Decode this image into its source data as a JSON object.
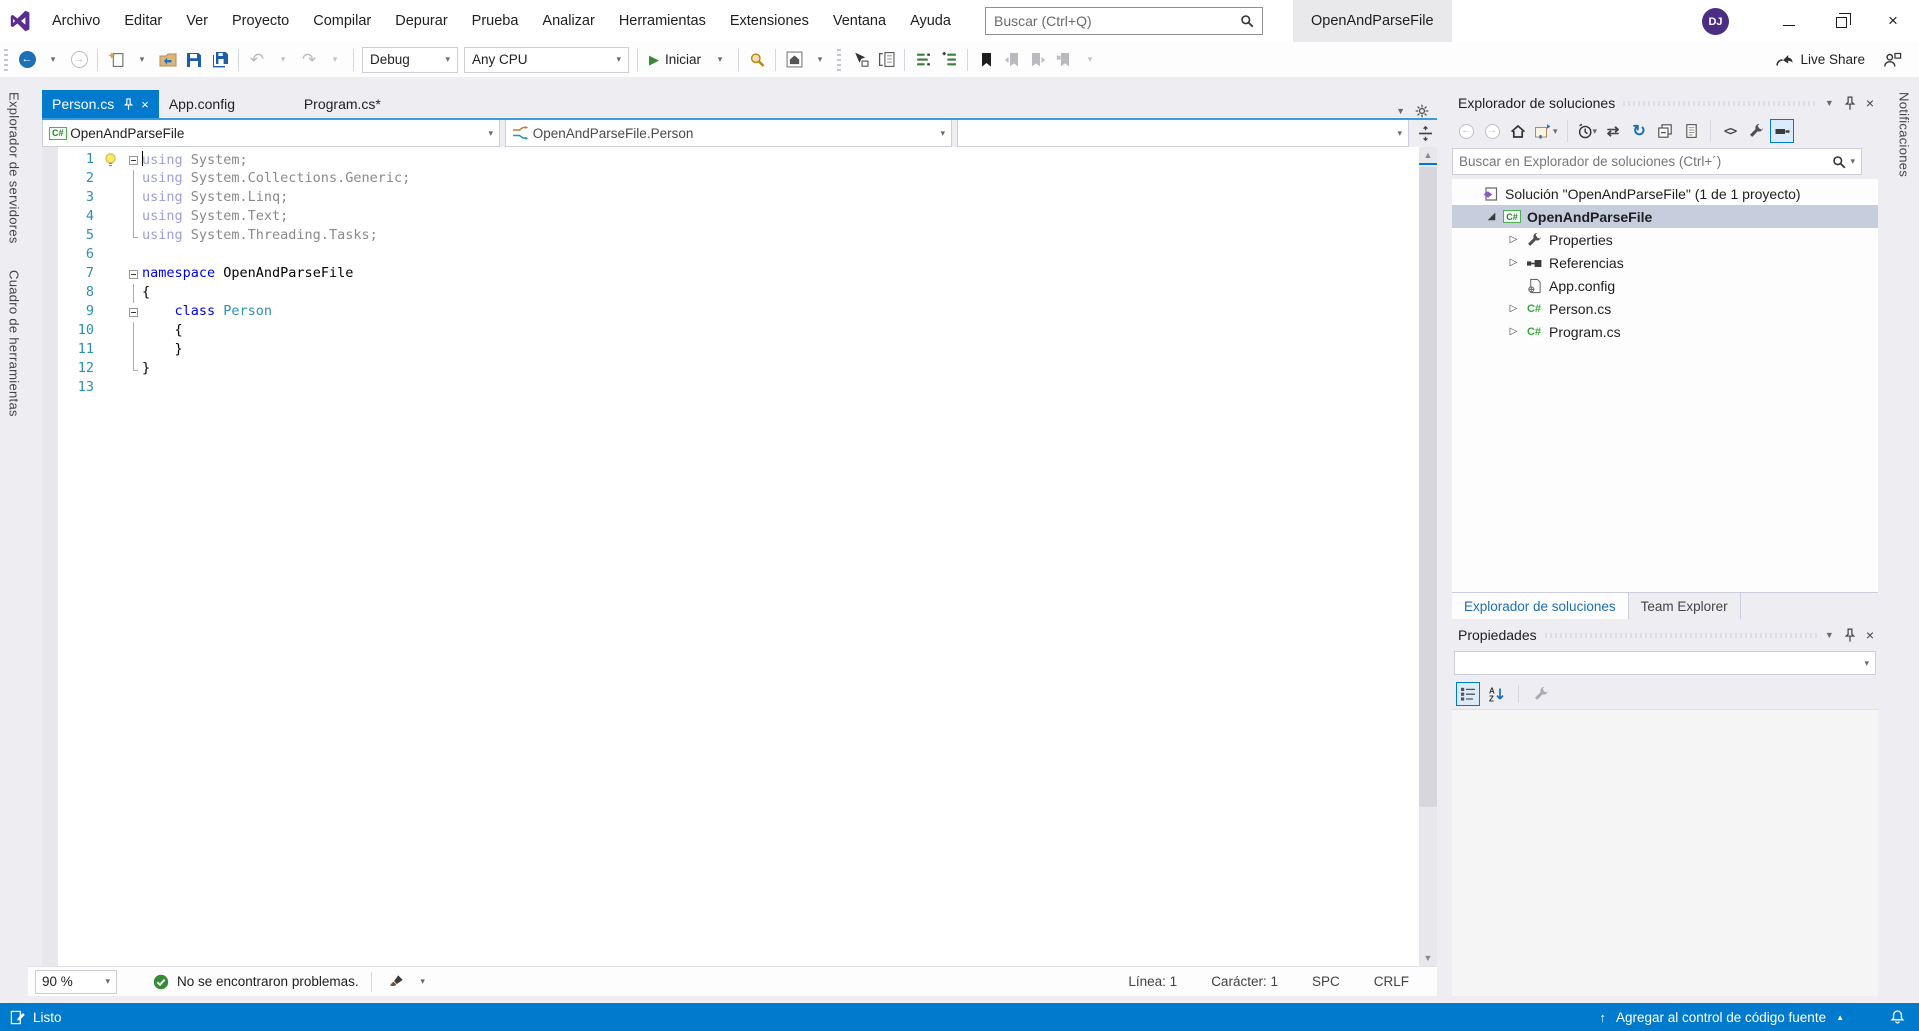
{
  "colors": {
    "accent": "#007ACC",
    "vs_purple": "#5C2D91",
    "keyword": "#0000E6",
    "type_name": "#2B91AF",
    "line_number": "#2B91AF",
    "faded_keyword": "#9D9DDB",
    "faded_code": "#8A8A8A",
    "success_green": "#388A34",
    "selection": "#C6CEDE"
  },
  "titlebar": {
    "menus": [
      "Archivo",
      "Editar",
      "Ver",
      "Proyecto",
      "Compilar",
      "Depurar",
      "Prueba",
      "Analizar",
      "Herramientas",
      "Extensiones",
      "Ventana",
      "Ayuda"
    ],
    "search_placeholder": "Buscar (Ctrl+Q)",
    "document_title": "OpenAndParseFile",
    "avatar_initials": "DJ"
  },
  "toolbar": {
    "debug_target": "Debug",
    "platform": "Any CPU",
    "start_label": "Iniciar",
    "live_share_label": "Live Share"
  },
  "left_rail": {
    "items": [
      "Explorador de servidores",
      "Cuadro de herramientas"
    ]
  },
  "right_rail": {
    "items": [
      "Notificaciones"
    ]
  },
  "editor": {
    "tabs": [
      {
        "label": "Person.cs",
        "active": true
      },
      {
        "label": "App.config",
        "active": false
      },
      {
        "label": "Program.cs*",
        "active": false
      }
    ],
    "navbar": {
      "project": "OpenAndParseFile",
      "type_member": "OpenAndParseFile.Person"
    },
    "code_lines": [
      {
        "n": 1,
        "fold": "minus",
        "bulb": true,
        "caret": true,
        "tokens": [
          {
            "t": "using",
            "s": "kw-dim"
          },
          {
            "t": " System;",
            "s": "dim"
          }
        ]
      },
      {
        "n": 2,
        "fold": "line",
        "tokens": [
          {
            "t": "using",
            "s": "kw-dim"
          },
          {
            "t": " System.Collections.Generic;",
            "s": "dim"
          }
        ]
      },
      {
        "n": 3,
        "fold": "line",
        "tokens": [
          {
            "t": "using",
            "s": "kw-dim"
          },
          {
            "t": " System.Linq;",
            "s": "dim"
          }
        ]
      },
      {
        "n": 4,
        "fold": "line",
        "tokens": [
          {
            "t": "using",
            "s": "kw-dim"
          },
          {
            "t": " System.Text;",
            "s": "dim"
          }
        ]
      },
      {
        "n": 5,
        "fold": "end",
        "tokens": [
          {
            "t": "using",
            "s": "kw-dim"
          },
          {
            "t": " System.Threading.Tasks;",
            "s": "dim"
          }
        ]
      },
      {
        "n": 6,
        "fold": "",
        "tokens": []
      },
      {
        "n": 7,
        "fold": "minus",
        "tokens": [
          {
            "t": "namespace",
            "s": "kw"
          },
          {
            "t": " OpenAndParseFile",
            "s": "plain"
          }
        ]
      },
      {
        "n": 8,
        "fold": "line",
        "tokens": [
          {
            "t": "{",
            "s": "plain"
          }
        ]
      },
      {
        "n": 9,
        "fold": "minus",
        "tokens": [
          {
            "t": "    ",
            "s": "plain"
          },
          {
            "t": "class",
            "s": "kw"
          },
          {
            "t": " ",
            "s": "plain"
          },
          {
            "t": "Person",
            "s": "type"
          }
        ]
      },
      {
        "n": 10,
        "fold": "line",
        "tokens": [
          {
            "t": "    {",
            "s": "plain"
          }
        ]
      },
      {
        "n": 11,
        "fold": "line",
        "tokens": [
          {
            "t": "    }",
            "s": "plain"
          }
        ]
      },
      {
        "n": 12,
        "fold": "end",
        "tokens": [
          {
            "t": "}",
            "s": "plain"
          }
        ]
      },
      {
        "n": 13,
        "fold": "",
        "tokens": []
      }
    ],
    "bottom_bar": {
      "zoom": "90 %",
      "health": "No se encontraron problemas.",
      "line": "Línea: 1",
      "column": "Carácter: 1",
      "whitespace": "SPC",
      "line_ending": "CRLF"
    }
  },
  "solution_explorer": {
    "title": "Explorador de soluciones",
    "search_placeholder": "Buscar en Explorador de soluciones (Ctrl+´)",
    "tree": [
      {
        "label": "Solución \"OpenAndParseFile\" (1 de 1 proyecto)",
        "icon": "solution",
        "indent": 0
      },
      {
        "label": "OpenAndParseFile",
        "icon": "csproject",
        "indent": 1,
        "selected": true,
        "bold": true,
        "expander": "expanded"
      },
      {
        "label": "Properties",
        "icon": "wrench",
        "indent": 2,
        "expander": "collapsed"
      },
      {
        "label": "Referencias",
        "icon": "references",
        "indent": 2,
        "expander": "collapsed"
      },
      {
        "label": "App.config",
        "icon": "config",
        "indent": 2
      },
      {
        "label": "Person.cs",
        "icon": "csfile",
        "indent": 2,
        "expander": "collapsed"
      },
      {
        "label": "Program.cs",
        "icon": "csfile",
        "indent": 2,
        "expander": "collapsed"
      }
    ],
    "bottom_tabs": [
      {
        "label": "Explorador de soluciones",
        "active": true
      },
      {
        "label": "Team Explorer",
        "active": false
      }
    ]
  },
  "properties_panel": {
    "title": "Propiedades"
  },
  "status_bar": {
    "ready": "Listo",
    "source_control": "Agregar al control de código fuente"
  }
}
